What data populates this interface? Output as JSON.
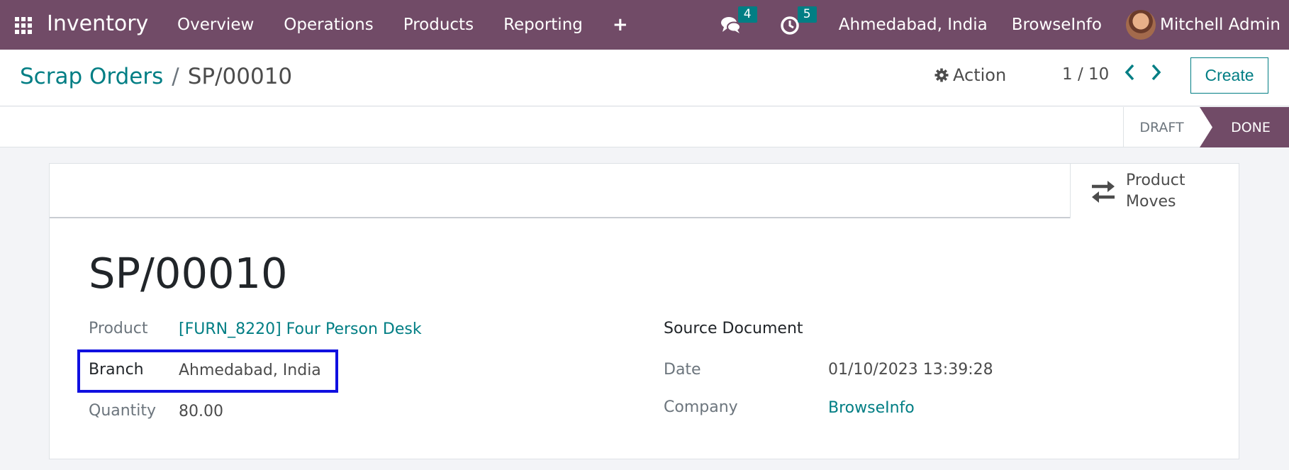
{
  "navbar": {
    "app_title": "Inventory",
    "menu": [
      "Overview",
      "Operations",
      "Products",
      "Reporting"
    ],
    "plus_icon": "+",
    "messages_badge": "4",
    "activities_badge": "5",
    "branch": "Ahmedabad, India",
    "company": "BrowseInfo",
    "user": "Mitchell Admin"
  },
  "control": {
    "breadcrumb_parent": "Scrap Orders",
    "breadcrumb_sep": "/",
    "breadcrumb_current": "SP/00010",
    "action_label": "Action",
    "pager": "1 / 10",
    "create_label": "Create"
  },
  "status": {
    "stages": [
      "DRAFT",
      "DONE"
    ],
    "active": "DONE"
  },
  "sheet": {
    "smart_button_label": "Product Moves",
    "record_name": "SP/00010",
    "left_fields": {
      "product_label": "Product",
      "product_value": "[FURN_8220] Four Person Desk",
      "branch_label": "Branch",
      "branch_value": "Ahmedabad, India",
      "quantity_label": "Quantity",
      "quantity_value": "80.00"
    },
    "right_fields": {
      "source_label": "Source Document",
      "date_label": "Date",
      "date_value": "01/10/2023 13:39:28",
      "company_label": "Company",
      "company_value": "BrowseInfo"
    }
  },
  "colors": {
    "brand": "#714b67",
    "accent": "#017e84",
    "highlight": "#1010e0"
  }
}
